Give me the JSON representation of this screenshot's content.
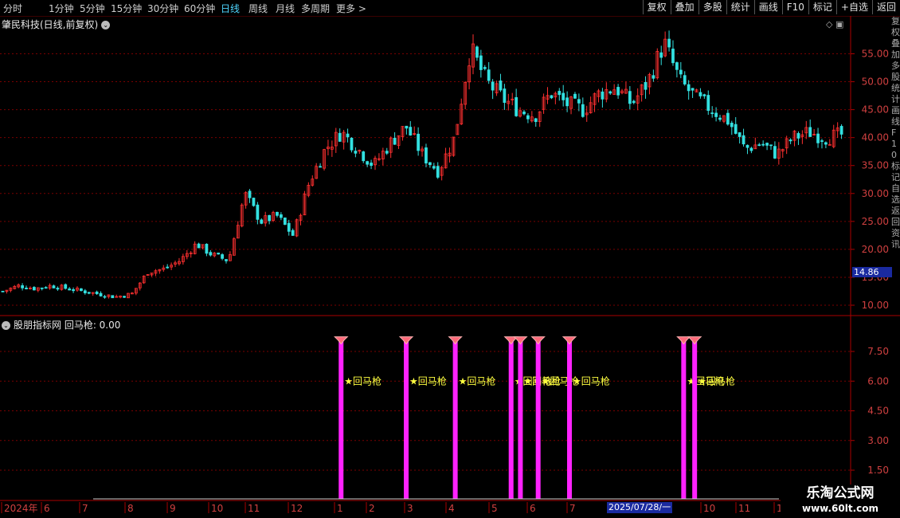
{
  "toolbar": {
    "periods": [
      "分时",
      "1分钟",
      "5分钟",
      "15分钟",
      "30分钟",
      "60分钟",
      "日线",
      "周线",
      "月线",
      "多周期",
      "更多 >"
    ],
    "active": "日线",
    "right_buttons": [
      "复权",
      "叠加",
      "多股",
      "统计",
      "画线",
      "F10",
      "标记",
      "+自选",
      "返回"
    ]
  },
  "main_panel": {
    "title": "肇民科技(日线,前复权)",
    "y_ticks": [
      "55.00",
      "50.00",
      "45.00",
      "40.00",
      "35.00",
      "30.00",
      "25.00",
      "20.00",
      "15.00",
      "10.00"
    ],
    "last_price": "14.86"
  },
  "sub_panel": {
    "title": "股朋指标网  回马枪: 0.00",
    "y_ticks": [
      "7.50",
      "6.00",
      "4.50",
      "3.00",
      "1.50"
    ],
    "signal_label": "★回马枪"
  },
  "x_axis": {
    "labels": [
      "2024年",
      "6",
      "7",
      "8",
      "9",
      "10",
      "11",
      "12",
      "1",
      "2",
      "3",
      "4",
      "5",
      "6",
      "7",
      "8",
      "9",
      "10",
      "11",
      "1"
    ],
    "cursor_date": "2025/07/28/一"
  },
  "watermark": {
    "line1": "乐淘公式网",
    "line2": "www.60lt.com"
  },
  "side_strip_text": "复权叠加多股统计画线F10标记自选返回资讯",
  "chart_data": {
    "type": "candlestick",
    "title": "肇民科技(日线,前复权)",
    "ylim": [
      8,
      60
    ],
    "y_ticks": [
      55,
      50,
      45,
      40,
      35,
      30,
      25,
      20,
      15,
      10
    ],
    "x_labels": [
      "2024年",
      "6",
      "7",
      "8",
      "9",
      "10",
      "11",
      "12",
      "1",
      "2",
      "3",
      "4",
      "5",
      "6",
      "7",
      "8",
      "9",
      "10",
      "11",
      "1"
    ],
    "close_path": [
      12.5,
      13.5,
      13,
      13.5,
      13,
      12.5,
      12,
      11.5,
      12,
      16,
      16.5,
      18,
      21,
      19,
      18,
      30,
      25,
      26,
      22.5,
      32,
      38,
      41,
      38,
      35,
      39,
      42,
      37,
      34,
      40,
      56,
      50,
      47,
      45,
      44,
      48,
      46,
      45,
      48,
      49,
      46,
      50,
      57,
      50,
      47,
      45,
      43,
      38,
      39,
      37,
      40,
      41,
      40,
      40.5
    ],
    "last_price": 14.86,
    "indicator": {
      "name": "回马枪",
      "current_value": 0.0,
      "ylim": [
        0,
        9
      ],
      "y_ticks": [
        7.5,
        6.0,
        4.5,
        3.0,
        1.5
      ],
      "signal_value": 8,
      "signal_positions": [
        0.375,
        0.452,
        0.51,
        0.576,
        0.587,
        0.608,
        0.645,
        0.78,
        0.793
      ]
    }
  }
}
